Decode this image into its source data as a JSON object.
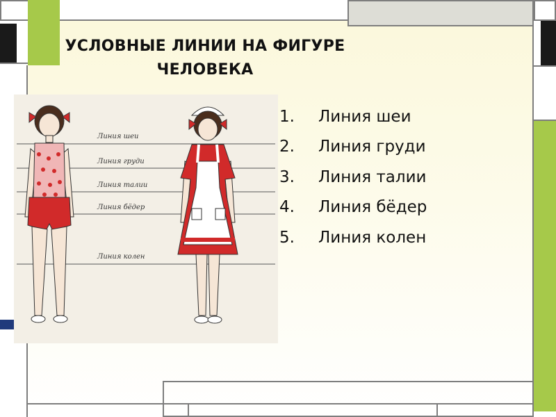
{
  "title": {
    "line1": "УСЛОВНЫЕ ЛИНИИ НА ФИГУРЕ",
    "line2": "ЧЕЛОВЕКА"
  },
  "figure_labels": [
    "Линия шеи",
    "Линия груди",
    "Линия талии",
    "Линия бёдер",
    "Линия колен"
  ],
  "list": [
    {
      "num": "1.",
      "text": "Линия шеи"
    },
    {
      "num": "2.",
      "text": "Линия груди"
    },
    {
      "num": "3.",
      "text": "Линия талии"
    },
    {
      "num": "4.",
      "text": "Линия бёдер"
    },
    {
      "num": "5.",
      "text": "Линия колен"
    }
  ],
  "colors": {
    "accent_green": "#a6c94a",
    "frame_gray": "#7d7d7d",
    "dark_block": "#1a1a1a",
    "panel_fill": "#ddddd6",
    "costume_red": "#d12a2a"
  }
}
